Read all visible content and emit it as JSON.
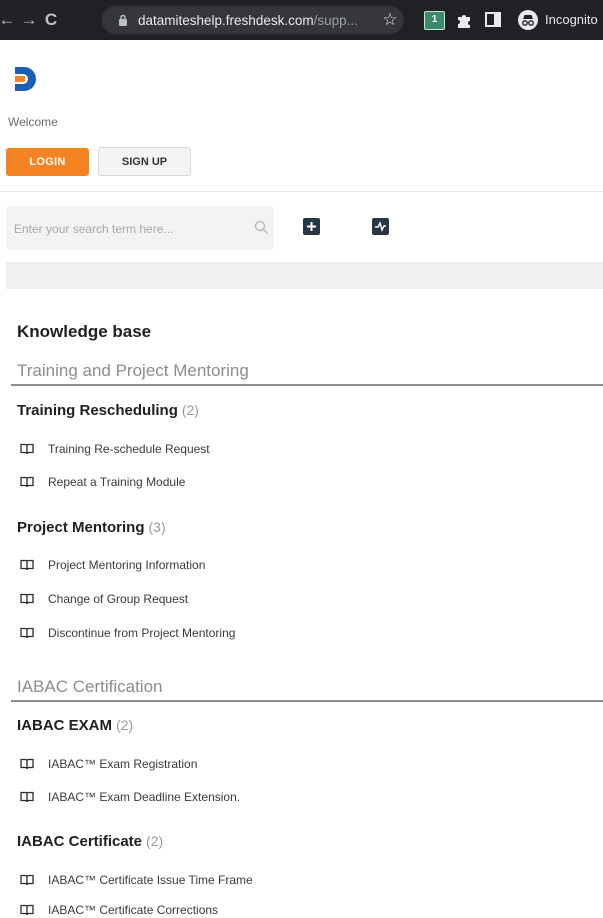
{
  "browser": {
    "url_host": "datamiteshelp.freshdesk.com",
    "url_path": "/supp...",
    "extension_badge": "1",
    "incognito_label": "Incognito"
  },
  "header": {
    "welcome": "Welcome",
    "login_label": "LOGIN",
    "signup_label": "SIGN UP"
  },
  "search": {
    "placeholder": "Enter your search term here..."
  },
  "kb": {
    "title": "Knowledge base",
    "categories": [
      {
        "name": "Training and Project Mentoring",
        "folders": [
          {
            "name": "Training Rescheduling",
            "count": "(2)",
            "articles": [
              "Training Re-schedule Request",
              "Repeat a Training Module"
            ]
          },
          {
            "name": "Project Mentoring",
            "count": "(3)",
            "articles": [
              "Project Mentoring Information",
              "Change of Group Request",
              "Discontinue from Project Mentoring"
            ]
          }
        ]
      },
      {
        "name": "IABAC Certification",
        "folders": [
          {
            "name": "IABAC EXAM",
            "count": "(2)",
            "articles": [
              "IABAC™ Exam Registration",
              "IABAC™ Exam Deadline Extension."
            ]
          },
          {
            "name": "IABAC Certificate",
            "count": "(2)",
            "articles": [
              "IABAC™ Certificate Issue Time Frame",
              "IABAC™ Certificate Corrections"
            ]
          }
        ]
      }
    ]
  },
  "colors": {
    "login_bg": "#f48421",
    "chrome_bg": "#202124",
    "tool_button": "#283745"
  }
}
